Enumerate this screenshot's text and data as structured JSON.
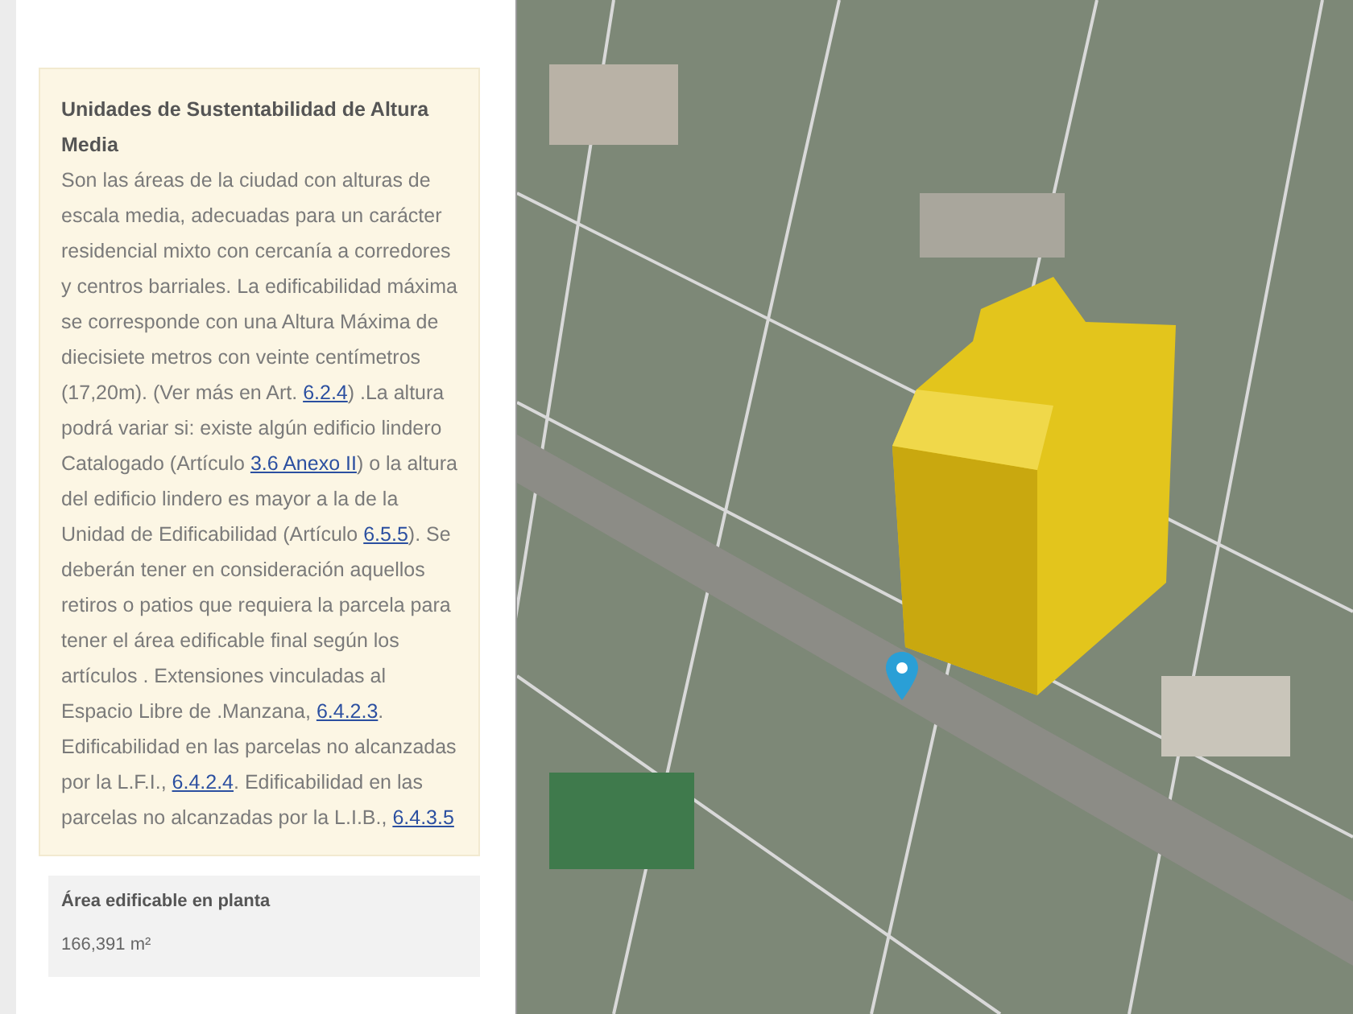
{
  "info_card": {
    "title": "Unidades de Sustentabilidad de Altura Media",
    "paragraph": [
      {
        "kind": "text",
        "text": "Son las áreas de la ciudad con alturas de escala media, adecuadas para un carácter residencial mixto con cercanía a corredores y centros barriales. La edificabilidad máxima se corresponde con una Altura Máxima de diecisiete metros con veinte centímetros (17,20m). (Ver más en Art. "
      },
      {
        "kind": "link",
        "text": "6.2.4"
      },
      {
        "kind": "text",
        "text": ") .La altura podrá variar si: existe algún edificio lindero Catalogado (Artículo "
      },
      {
        "kind": "link",
        "text": "3.6 Anexo II"
      },
      {
        "kind": "text",
        "text": ") o la altura del edificio lindero es mayor a la de la Unidad de Edificabilidad (Artículo "
      },
      {
        "kind": "link",
        "text": "6.5.5"
      },
      {
        "kind": "text",
        "text": "). Se deberán tener en consideración aquellos retiros o patios que requiera la parcela para tener el área edificable final según los artículos . Extensiones vinculadas al Espacio Libre de .Manzana, "
      },
      {
        "kind": "link",
        "text": "6.4.2.3"
      },
      {
        "kind": "text",
        "text": ". Edificabilidad en las parcelas no alcanzadas por la L.F.I., "
      },
      {
        "kind": "link",
        "text": "6.4.2.4"
      },
      {
        "kind": "text",
        "text": ". Edificabilidad en las parcelas no alcanzadas por la L.I.B., "
      },
      {
        "kind": "link",
        "text": "6.4.3.5"
      }
    ]
  },
  "area_card": {
    "label": "Área edificable en planta",
    "value": "166,391 m²"
  }
}
